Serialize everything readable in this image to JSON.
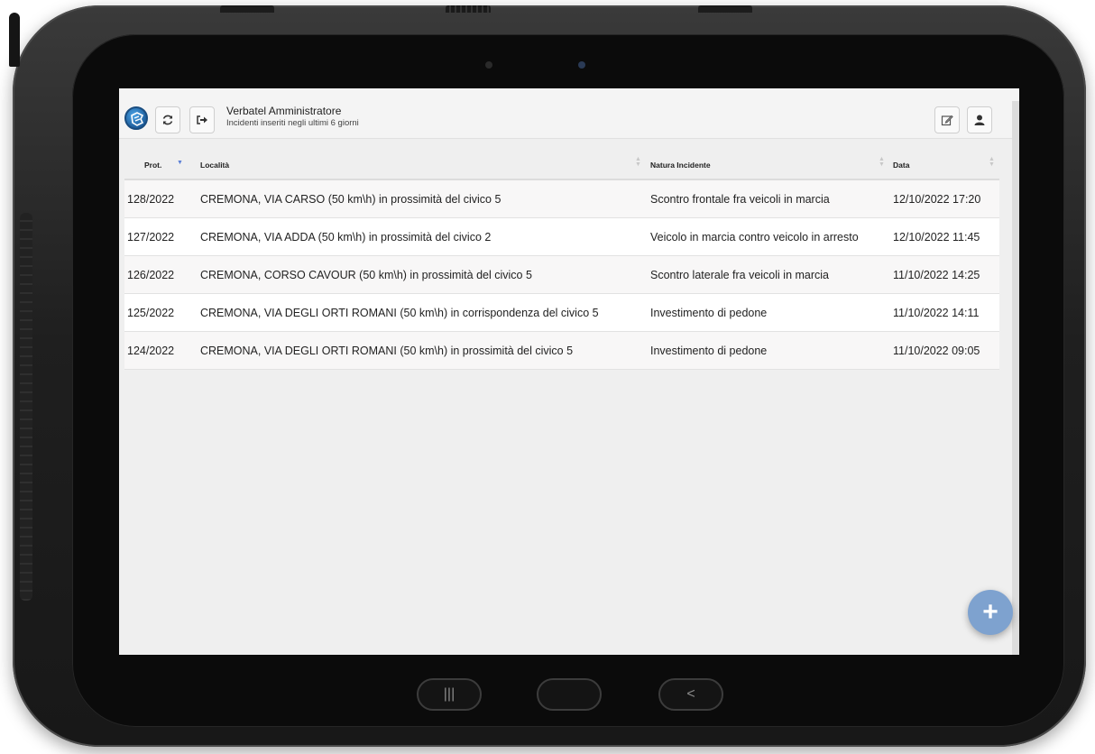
{
  "header": {
    "title": "Verbatel Amministratore",
    "subtitle": "Incidenti inseriti negli ultimi 6 giorni",
    "icons": [
      "app-logo",
      "refresh-icon",
      "logout-icon",
      "edit-icon",
      "user-icon"
    ]
  },
  "table": {
    "columns": {
      "prot": "Prot.",
      "localita": "Località",
      "natura": "Natura Incidente",
      "data": "Data"
    },
    "rows": [
      {
        "prot": "128/2022",
        "localita": "CREMONA, VIA CARSO (50 km\\h) in prossimità del civico 5",
        "natura": "Scontro frontale fra veicoli in marcia",
        "data": "12/10/2022 17:20"
      },
      {
        "prot": "127/2022",
        "localita": "CREMONA, VIA ADDA (50 km\\h) in prossimità del civico 2",
        "natura": "Veicolo in marcia contro veicolo in arresto",
        "data": "12/10/2022 11:45"
      },
      {
        "prot": "126/2022",
        "localita": "CREMONA, CORSO CAVOUR (50 km\\h) in prossimità del civico 5",
        "natura": "Scontro laterale fra veicoli in marcia",
        "data": "11/10/2022 14:25"
      },
      {
        "prot": "125/2022",
        "localita": "CREMONA, VIA DEGLI ORTI ROMANI (50 km\\h) in corrispondenza del civico 5",
        "natura": "Investimento di pedone",
        "data": "11/10/2022 14:11"
      },
      {
        "prot": "124/2022",
        "localita": "CREMONA, VIA DEGLI ORTI ROMANI (50 km\\h) in prossimità del civico 5",
        "natura": "Investimento di pedone",
        "data": "11/10/2022 09:05"
      }
    ]
  },
  "fab": {
    "label": "+"
  },
  "colors": {
    "accent": "#7ea2cf",
    "sort_active": "#5b7fd6"
  }
}
